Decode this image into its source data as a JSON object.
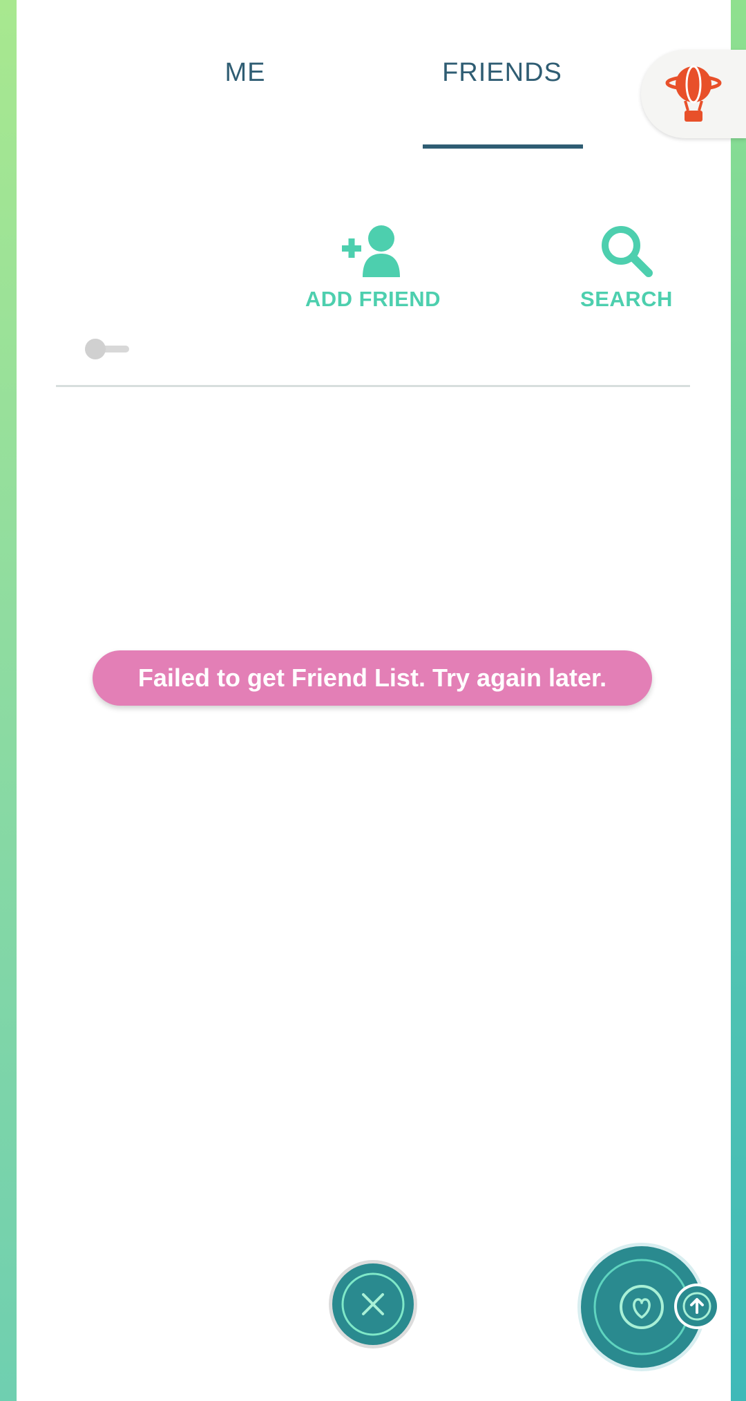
{
  "tabs": [
    {
      "label": "ME",
      "active": false
    },
    {
      "label": "FRIENDS",
      "active": true
    }
  ],
  "actions": {
    "add_friend_label": "ADD FRIEND",
    "search_label": "SEARCH"
  },
  "toast": {
    "message": "Failed to get Friend List. Try again later."
  },
  "icons": {
    "balloon": "hot-air-balloon-icon",
    "add_friend": "add-person-icon",
    "search": "magnifier-icon",
    "close": "close-icon",
    "gift": "heart-icon",
    "up": "arrow-up-icon"
  },
  "colors": {
    "accent": "#4dcfae",
    "tab_text": "#2f5d73",
    "toast": "#e37fb6",
    "button": "#2a8a8f",
    "balloon": "#e8502a"
  },
  "toggle": {
    "on": false
  }
}
